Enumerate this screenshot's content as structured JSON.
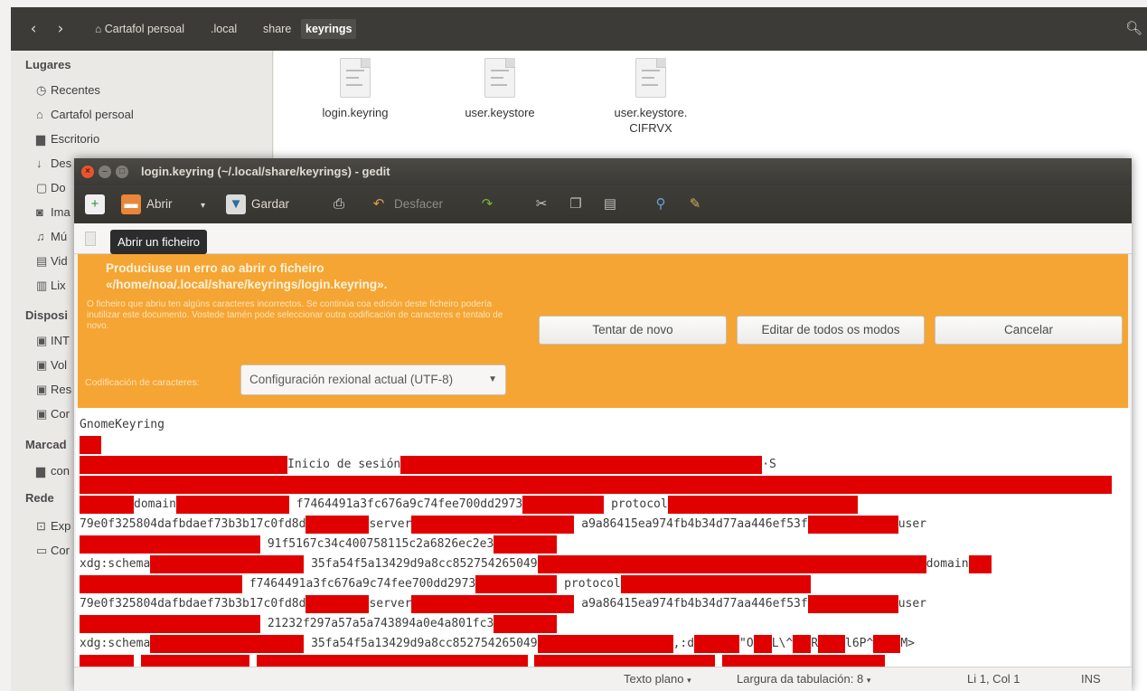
{
  "files": {
    "header": {
      "back_icon": "chevron-left-icon",
      "forward_icon": "chevron-right-icon",
      "home_icon": "home-icon",
      "path": [
        "Cartafol persoal",
        ".local",
        "share",
        "keyrings"
      ],
      "search_icon": "search-icon"
    },
    "sidebar": {
      "places_heading": "Lugares",
      "places": [
        "Recentes",
        "Cartafol persoal",
        "Escritorio",
        "Des",
        "Do",
        "Ima",
        "Mú",
        "Vid",
        "Lix"
      ],
      "devices_heading": "Disposi",
      "devices": [
        "INT",
        "Vol",
        "Res",
        "Cor"
      ],
      "bookmarks_heading": "Marcad",
      "bookmarks": [
        "con"
      ],
      "network_heading": "Rede",
      "network": [
        "Exp",
        "Cor"
      ]
    },
    "content": {
      "items": [
        {
          "name": "login.keyring",
          "icon": "document-icon"
        },
        {
          "name": "user.keystore",
          "icon": "document-icon"
        },
        {
          "name": "user.keystore.\nCIFRVX",
          "icon": "text-document-icon"
        }
      ]
    }
  },
  "gedit": {
    "title": "login.keyring (~/.local/share/keyrings) - gedit",
    "toolbar": {
      "open": "Abrir",
      "save": "Gardar",
      "undo": "Desfacer"
    },
    "tooltip": "Abrir un ficheiro",
    "infobar": {
      "title": "Produciuse un erro ao abrir o ficheiro «/home/noa/.local/share/keyrings/login.keyring».",
      "message": "O ficheiro que abriu ten algúns caracteres incorrectos. Se continúa coa edición deste ficheiro podería inutilizar este documento. Vostede tamén pode seleccionar outra codificación de caracteres e tentalo de novo.",
      "encoding_label": "Codificación de caracteres:",
      "encoding_value": "Configuración rexional actual (UTF-8)",
      "retry_button": "Tentar de novo",
      "edit_anyway_button": "Editar de todos os modos",
      "cancel_button": "Cancelar"
    },
    "editor": {
      "lines": [
        [
          {
            "t": "GnomeKeyring"
          }
        ],
        [
          {
            "r": 24
          }
        ],
        [
          {
            "r": 230
          },
          {
            "t": "Inicio de sesión"
          },
          {
            "r": 400
          },
          {
            "t": "·S"
          }
        ],
        [
          {
            "r": 1142
          }
        ],
        [
          {
            "r": 60
          },
          {
            "t": "domain"
          },
          {
            "r": 125
          },
          {
            "t": " f7464491a3fc676a9c74fee700dd2973"
          },
          {
            "r": 90
          },
          {
            "t": " protocol"
          },
          {
            "r": 210
          }
        ],
        [
          {
            "t": "79e0f325804dafbdaef73b3b17c0fd8d"
          },
          {
            "r": 70
          },
          {
            "t": "server"
          },
          {
            "r": 180
          },
          {
            "t": " a9a86415ea974fb4b34d77aa446ef53f"
          },
          {
            "r": 100
          },
          {
            "t": "user"
          }
        ],
        [
          {
            "r": 200
          },
          {
            "t": " 91f5167c34c400758115c2a6826ec2e3"
          },
          {
            "r": 70
          }
        ],
        [
          {
            "t": "xdg:schema"
          },
          {
            "r": 170
          },
          {
            "t": " 35fa54f5a13429d9a8cc852754265049"
          },
          {
            "r": 430
          },
          {
            "t": "domain"
          },
          {
            "r": 25
          }
        ],
        [
          {
            "r": 180
          },
          {
            "t": " f7464491a3fc676a9c74fee700dd2973"
          },
          {
            "r": 90
          },
          {
            "t": " protocol"
          },
          {
            "r": 210
          }
        ],
        [
          {
            "t": "79e0f325804dafbdaef73b3b17c0fd8d"
          },
          {
            "r": 70
          },
          {
            "t": "server"
          },
          {
            "r": 180
          },
          {
            "t": " a9a86415ea974fb4b34d77aa446ef53f"
          },
          {
            "r": 100
          },
          {
            "t": "user"
          }
        ],
        [
          {
            "r": 200
          },
          {
            "t": " 21232f297a57a5a743894a0e4a801fc3"
          },
          {
            "r": 70
          }
        ],
        [
          {
            "t": "xdg:schema"
          },
          {
            "r": 170
          },
          {
            "t": " 35fa54f5a13429d9a8cc852754265049"
          },
          {
            "r": 150
          },
          {
            "t": ",:d"
          },
          {
            "r": 50
          },
          {
            "t": "\"O"
          },
          {
            "r": 20
          },
          {
            "t": "L\\^"
          },
          {
            "r": 20
          },
          {
            "t": "R"
          },
          {
            "r": 30
          },
          {
            "t": "l6P^"
          },
          {
            "r": 30
          },
          {
            "t": "M>"
          }
        ],
        [
          {
            "r": 60
          },
          {
            "t": "  "
          },
          {
            "r": 120
          },
          {
            "t": "  "
          },
          {
            "r": 300
          },
          {
            "t": "  "
          },
          {
            "r": 200
          },
          {
            "t": "  "
          },
          {
            "r": 180
          }
        ]
      ]
    },
    "statusbar": {
      "language": "Texto plano",
      "tab_width": "Largura da tabulación: 8",
      "position": "Li 1, Col 1",
      "mode": "INS"
    }
  }
}
